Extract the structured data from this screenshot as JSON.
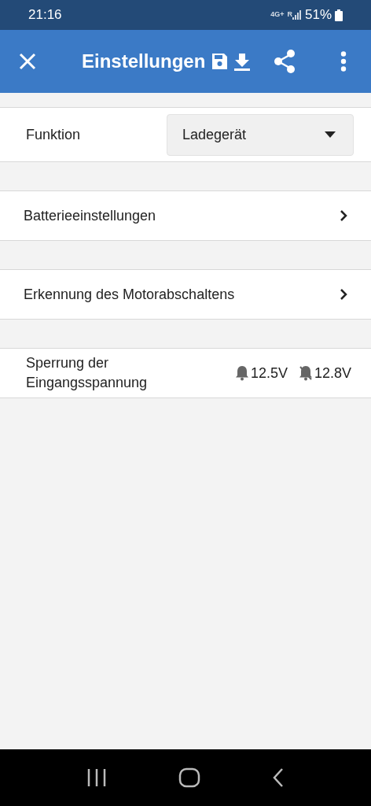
{
  "status_bar": {
    "time": "21:16",
    "network": "4G+",
    "roaming": "R",
    "battery": "51%"
  },
  "app_bar": {
    "title": "Einstellungen"
  },
  "sections": [
    {
      "kind": "dropdown",
      "label": "Funktion",
      "value": "Ladegerät"
    },
    {
      "kind": "link",
      "label": "Batterieeinstellungen"
    },
    {
      "kind": "link",
      "label": "Erkennung des Motorabschaltens"
    },
    {
      "kind": "alarm",
      "label": "Sperrung der Eingangsspannung",
      "on_value": "12.5V",
      "off_value": "12.8V"
    }
  ]
}
